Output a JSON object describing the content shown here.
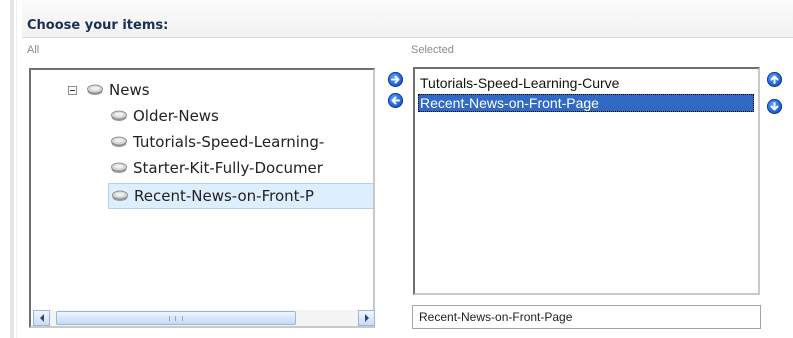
{
  "header": {
    "title": "Choose your items:"
  },
  "columns": {
    "all_label": "All",
    "selected_label": "Selected"
  },
  "tree": {
    "root": {
      "label": "News",
      "expanded": true,
      "icon": "stack-icon"
    },
    "children": [
      {
        "label": "Older-News",
        "icon": "stack-icon"
      },
      {
        "label": "Tutorials-Speed-Learning-",
        "icon": "stack-icon"
      },
      {
        "label": "Starter-Kit-Fully-Documer",
        "icon": "stack-icon"
      },
      {
        "label": "Recent-News-on-Front-P",
        "icon": "stack-icon",
        "selected": true
      }
    ],
    "scrollbar": {
      "grip_glyph": "III"
    }
  },
  "transfer_buttons": {
    "add": "arrow-right-icon",
    "remove": "arrow-left-icon"
  },
  "order_buttons": {
    "up": "arrow-up-icon",
    "down": "arrow-down-icon"
  },
  "selected_items": [
    {
      "label": "Tutorials-Speed-Learning-Curve",
      "active": false
    },
    {
      "label": "Recent-News-on-Front-Page",
      "active": true
    }
  ],
  "name_field": {
    "value": "Recent-News-on-Front-Page"
  },
  "colors": {
    "title": "#1a2f55",
    "accent_blue": "#1656c8",
    "selection_bg": "#316ac5",
    "tree_selection_bg": "#ddeeff"
  }
}
